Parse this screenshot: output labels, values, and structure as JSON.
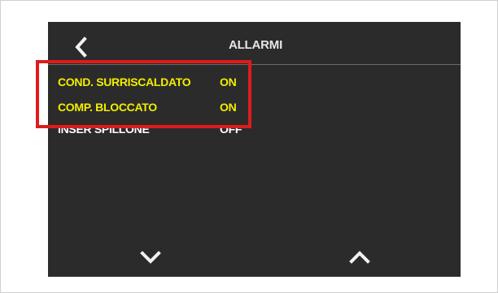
{
  "header": {
    "title": "ALLARMI",
    "back_icon": "chevron-left-icon"
  },
  "alarms": [
    {
      "label": "COND. SURRISCALDATO",
      "value": "ON",
      "color": "#f2ee00"
    },
    {
      "label": "COMP. BLOCCATO",
      "value": "ON",
      "color": "#f2ee00"
    },
    {
      "label": "INSER SPILLONE",
      "value": "OFF",
      "color": "#ffffff"
    }
  ],
  "navigation": {
    "down_icon": "chevron-down-icon",
    "up_icon": "chevron-up-icon"
  },
  "colors": {
    "screen_background": "#2b2b2b",
    "active_alarm": "#f2ee00",
    "highlight": "#e01b1b"
  }
}
